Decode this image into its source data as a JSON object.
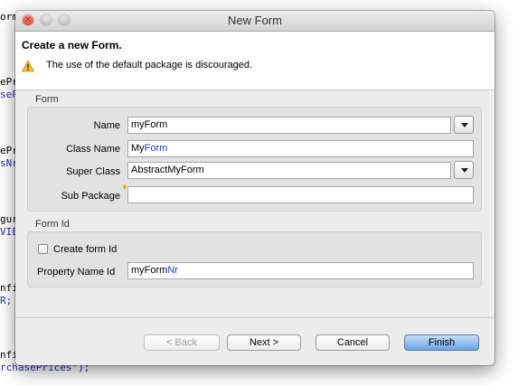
{
  "background_editor": {
    "lines": [
      {
        "text": "orm",
        "blue": false
      },
      {
        "text": "ePr",
        "blue": false
      },
      {
        "text": "seP",
        "blue": true
      },
      {
        "text": "ePr",
        "blue": false
      },
      {
        "text": "sNr",
        "blue": true
      },
      {
        "text": "gur",
        "blue": false
      },
      {
        "text": "VIE",
        "blue": true
      },
      {
        "text": "nfi",
        "blue": false
      },
      {
        "text": "R;",
        "blue": true
      },
      {
        "text": "nfi",
        "blue": false
      },
      {
        "text": "rchasePrices\");",
        "blue": false
      }
    ]
  },
  "window": {
    "title": "New Form",
    "close_glyph": "×"
  },
  "header": {
    "title": "Create a new Form.",
    "message": "The use of the default package is discouraged."
  },
  "form_group": {
    "label": "Form",
    "name_label": "Name",
    "name_value": "myForm",
    "class_name_label": "Class Name",
    "class_name_prefix": "My",
    "class_name_suffix": "Form",
    "super_class_label": "Super Class",
    "super_class_value": "AbstractMyForm",
    "sub_package_label": "Sub Package",
    "sub_package_value": ""
  },
  "form_id_group": {
    "label": "Form Id",
    "create_form_id_label": "Create form Id",
    "create_form_id_checked": false,
    "property_name_label": "Property Name Id",
    "property_name_prefix": "myForm",
    "property_name_suffix": "Nr"
  },
  "buttons": {
    "back": "< Back",
    "next": "Next >",
    "cancel": "Cancel",
    "finish": "Finish"
  },
  "colors": {
    "warning": "#f2c037",
    "link_blue": "#1a3ac8",
    "default_button": "#6aa3e6"
  }
}
